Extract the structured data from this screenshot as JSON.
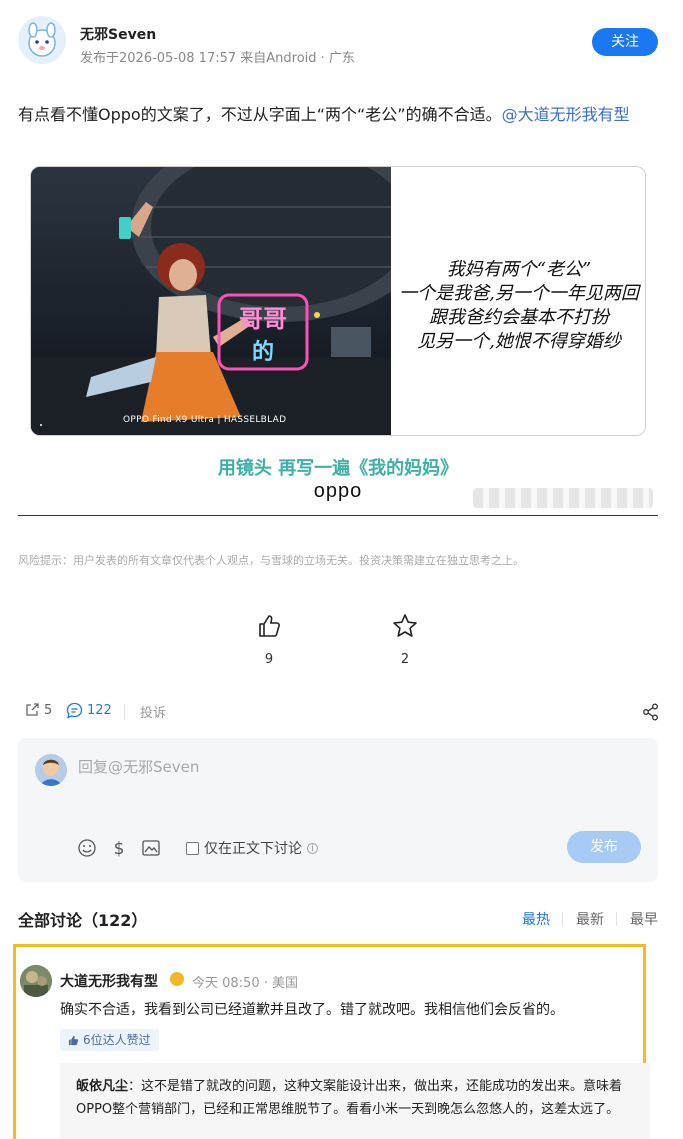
{
  "author": {
    "name": "无邪Seven",
    "meta": "发布于2026-05-08 17:57  来自Android  ·  广东",
    "follow_label": "关注"
  },
  "post": {
    "text": "有点看不懂Oppo的文案了，不过从字面上“两个“老公”的确不合适。",
    "mention": "@大道无形我有型"
  },
  "ad": {
    "handwriting": [
      "我妈有两个“老公”",
      "一个是我爸,另一个一年见两回",
      "跟我爸约会基本不打扮",
      "见另一个,她恨不得穿婚纱"
    ],
    "neon": [
      "哥哥",
      "的"
    ],
    "caption": "OPPO Find X9 Ultra  |  HASSELBLAD",
    "slogan": "用镜头 再写一遍《我的妈妈》",
    "brand": "oppo"
  },
  "risk_notice": "风险提示：用户发表的所有文章仅代表个人观点，与雪球的立场无关。投资决策需建立在独立思考之上。",
  "actions": {
    "like_count": "9",
    "favorite_count": "2"
  },
  "stats": {
    "share_count": "5",
    "comment_count": "122",
    "report_label": "投诉"
  },
  "reply": {
    "placeholder": "回复@无邪Seven",
    "checkbox_label": "仅在正文下讨论",
    "publish_label": "发布"
  },
  "discussion": {
    "title": "全部讨论（122）",
    "sorts": [
      "最热",
      "最新",
      "最早"
    ]
  },
  "comment": {
    "name": "大道无形我有型",
    "meta": "今天 08:50  ·  美国",
    "body": "确实不合适，我看到公司已经道歉并且改了。错了就改吧。我相信他们会反省的。",
    "likes": "6位达人赞过",
    "sub_reply": {
      "name": "皈依凡尘",
      "text": "：这不是错了就改的问题，这种文案能设计出来，做出来，还能成功的发出来。意味着OPPO整个营销部门，已经和正常思维脱节了。看看小米一天到晚怎么忽悠人的，这差太远了。"
    }
  },
  "colors": {
    "accent": "#1a78f2",
    "mention": "#3a6fd8",
    "highlight_border": "#f2bd21",
    "slogan": "#3fb0a6"
  }
}
